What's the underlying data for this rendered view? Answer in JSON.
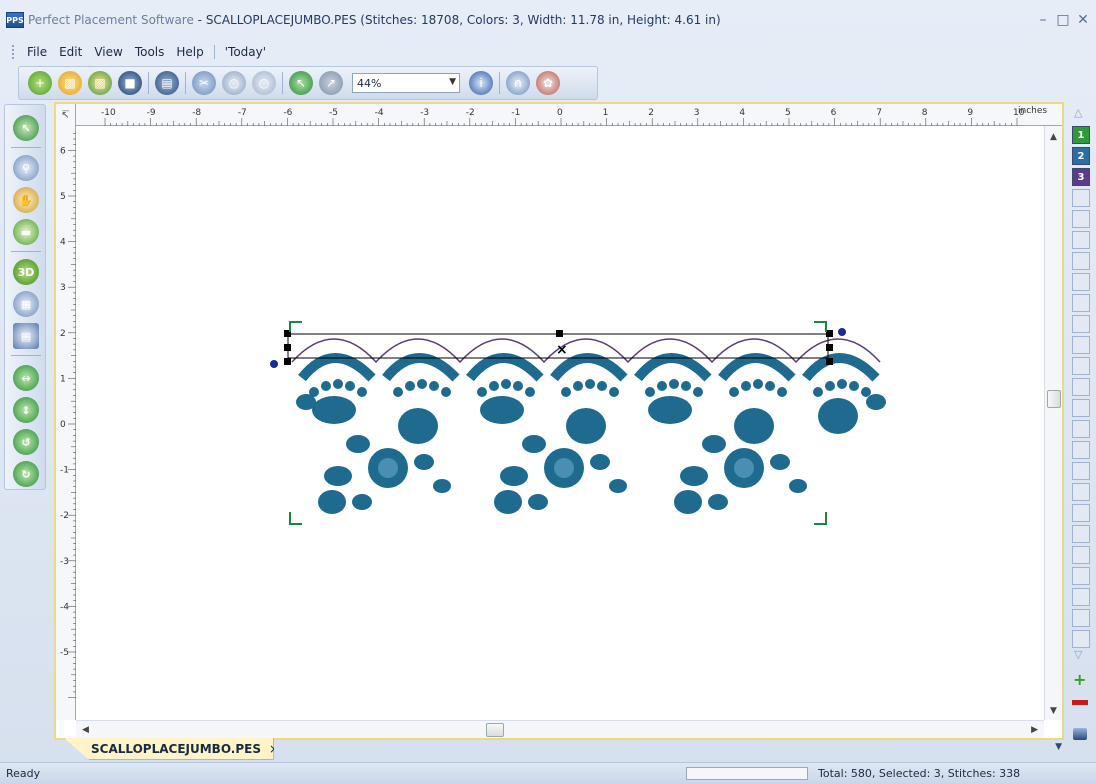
{
  "window": {
    "app_name": "Perfect Placement Software",
    "title_rest": " - SCALLOPLACEJUMBO.PES (Stitches: 18708, Colors: 3, Width: 11.78 in, Height: 4.61 in)",
    "icon_label": "PPS"
  },
  "menu": {
    "items": [
      "File",
      "Edit",
      "View",
      "Tools",
      "Help"
    ],
    "extra": "'Today'"
  },
  "toolbar": {
    "zoom": "44%",
    "buttons": [
      "new-icon",
      "open-icon",
      "open-recent-icon",
      "save-icon",
      "print-icon",
      "cut-icon",
      "copy-icon",
      "paste-icon",
      "select-icon",
      "move-icon",
      "info-icon",
      "hoop-icon",
      "design-icon"
    ]
  },
  "left_tools": [
    "select-icon",
    "zoom-icon",
    "pan-icon",
    "measure-icon",
    "3D",
    "grid-icon",
    "clipboard-icon",
    "flip-horizontal-icon",
    "flip-vertical-icon",
    "rotate-left-icon",
    "rotate-right-icon"
  ],
  "ruler": {
    "unit": "inches",
    "top_ticks": [
      "-10",
      "-9",
      "-8",
      "-7",
      "-6",
      "-5",
      "-4",
      "-3",
      "-2",
      "-1",
      "0",
      "1",
      "2",
      "3",
      "4",
      "5",
      "6",
      "7",
      "8",
      "9",
      "10"
    ],
    "left_ticks": [
      "6",
      "5",
      "4",
      "3",
      "2",
      "1",
      "0",
      "-1",
      "-2",
      "-3",
      "-4",
      "-5"
    ]
  },
  "tab": {
    "name": "SCALLOPLACEJUMBO.PES",
    "close": "×"
  },
  "palette": {
    "swatches": [
      {
        "label": "1",
        "color": "#2e9a3a"
      },
      {
        "label": "2",
        "color": "#2a6ea8"
      },
      {
        "label": "3",
        "color": "#5b3c8c"
      }
    ]
  },
  "colors": {
    "embroidery": "#1f6a8f",
    "handles": "#1a8a3a"
  },
  "status": {
    "left": "Ready",
    "right": "Total: 580, Selected: 3, Stitches: 338"
  }
}
